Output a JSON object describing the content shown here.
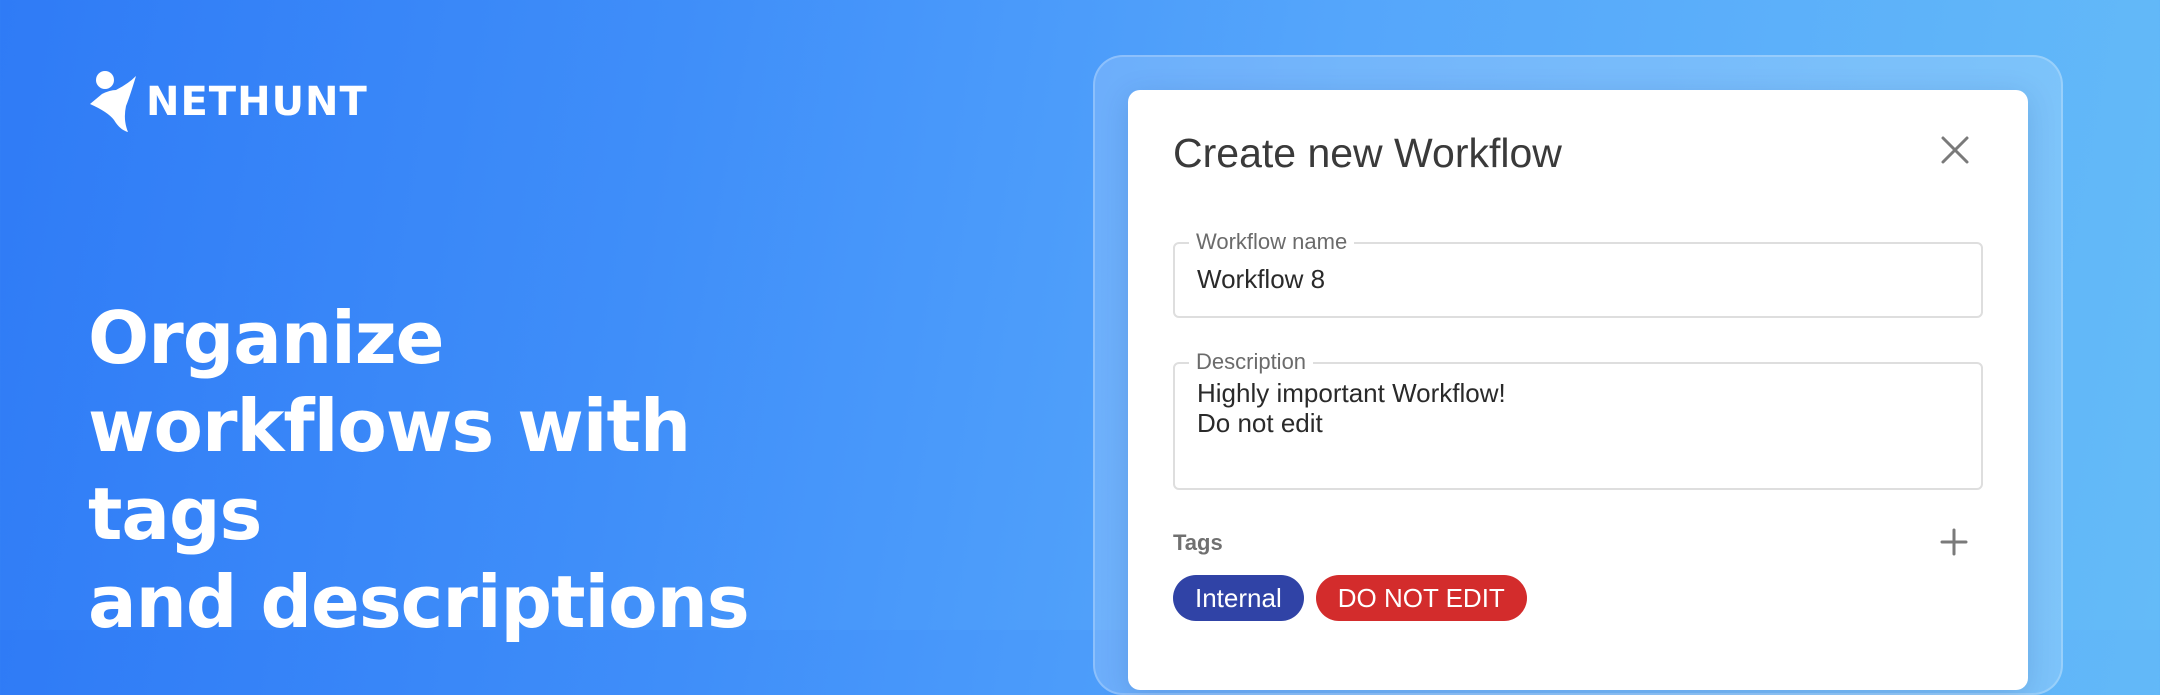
{
  "brand": {
    "name": "NETHUNT"
  },
  "headline": {
    "line1": "Organize",
    "line2": "workflows with tags",
    "line3": "and descriptions"
  },
  "dialog": {
    "title": "Create new Workflow",
    "workflow_name": {
      "label": "Workflow name",
      "value": "Workflow 8"
    },
    "description": {
      "label": "Description",
      "value": "Highly important Workflow!\nDo not edit"
    },
    "tags_label": "Tags",
    "tags": [
      {
        "label": "Internal",
        "color": "#3043a6"
      },
      {
        "label": "DO NOT EDIT",
        "color": "#d32c2c"
      }
    ]
  },
  "icons": {
    "close": "close-icon",
    "add": "plus-icon",
    "logo": "nethunt-logo-icon"
  }
}
